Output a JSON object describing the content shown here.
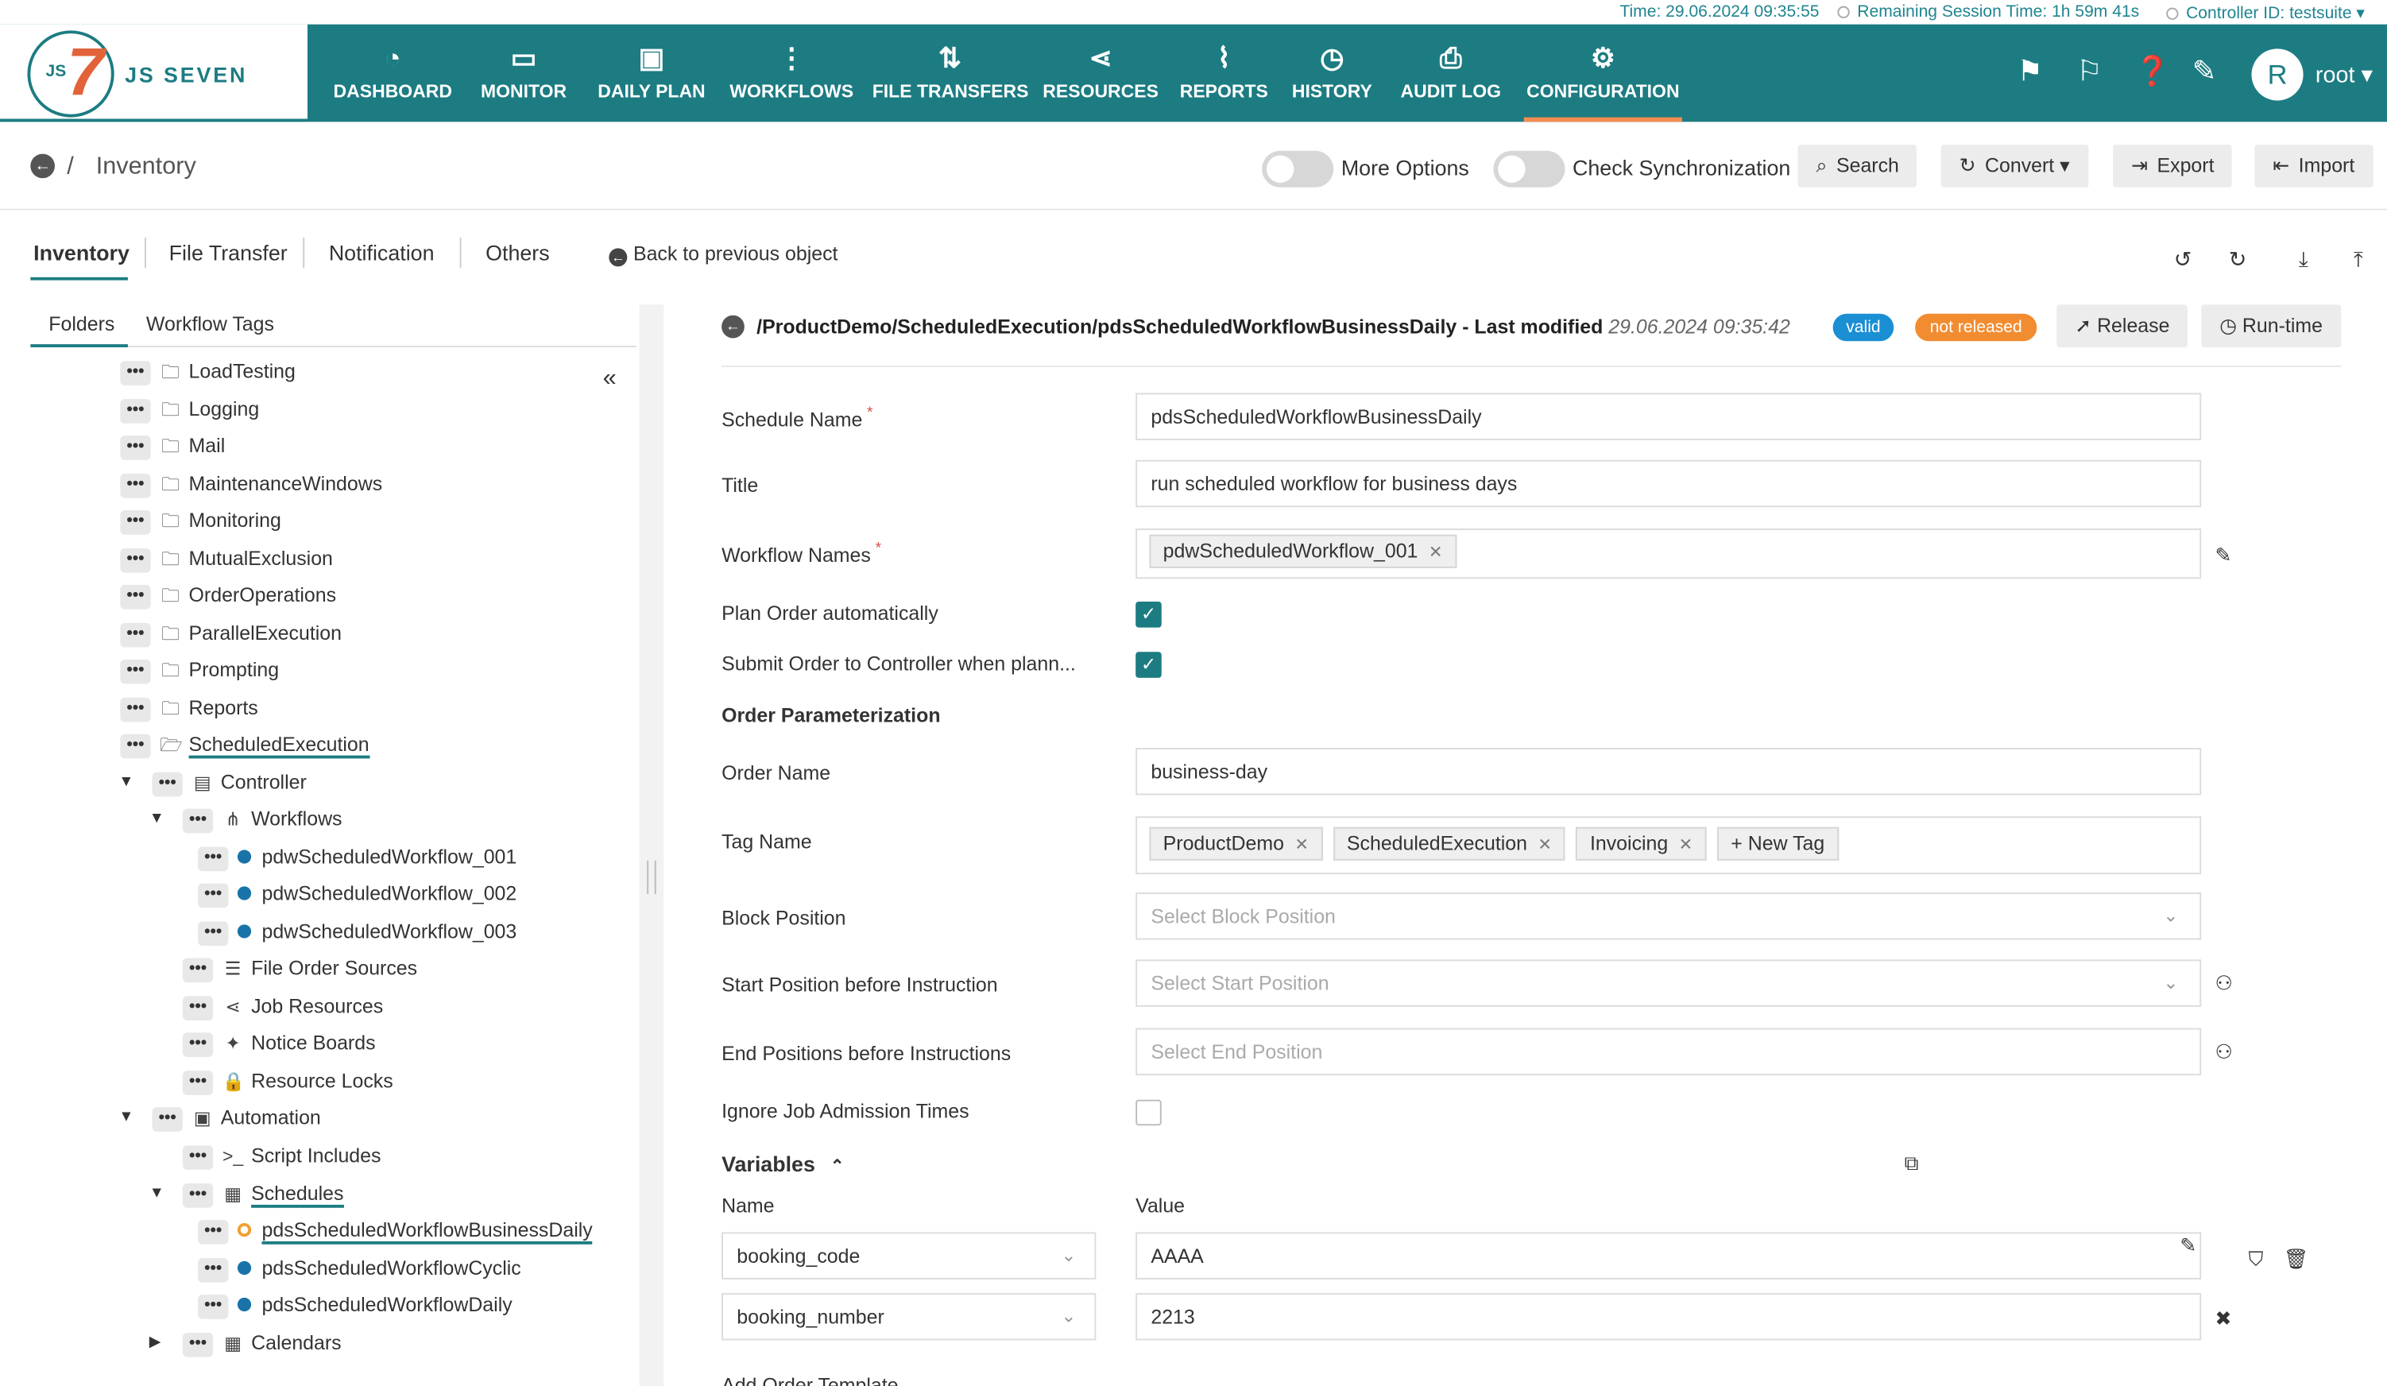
{
  "topbar": {
    "time": "Time: 29.06.2024 09:35:55",
    "session": "Remaining Session Time: 1h 59m 41s",
    "controller": "Controller ID: testsuite"
  },
  "header": {
    "logo_text": "JS SEVEN",
    "logo_js": "JS",
    "logo_seven": "7",
    "nav": [
      {
        "label": "DASHBOARD",
        "icon": "dashboard-icon"
      },
      {
        "label": "MONITOR",
        "icon": "monitor-icon"
      },
      {
        "label": "DAILY PLAN",
        "icon": "calendar-clock-icon"
      },
      {
        "label": "WORKFLOWS",
        "icon": "workflow-icon"
      },
      {
        "label": "FILE TRANSFERS",
        "icon": "transfer-icon"
      },
      {
        "label": "RESOURCES",
        "icon": "share-icon"
      },
      {
        "label": "REPORTS",
        "icon": "chart-icon"
      },
      {
        "label": "HISTORY",
        "icon": "history-icon"
      },
      {
        "label": "AUDIT LOG",
        "icon": "audit-icon"
      },
      {
        "label": "CONFIGURATION",
        "icon": "gear-icon"
      }
    ],
    "avatar_initial": "R",
    "user": "root"
  },
  "toolbar": {
    "title": "Inventory",
    "more_options": "More Options",
    "check_sync": "Check Synchronization",
    "search": "Search",
    "convert": "Convert",
    "export": "Export",
    "import": "Import"
  },
  "tabs": {
    "inventory": "Inventory",
    "file_transfer": "File Transfer",
    "notification": "Notification",
    "others": "Others",
    "back": "Back to previous object"
  },
  "sidebar": {
    "folders": "Folders",
    "workflow_tags": "Workflow Tags",
    "tree": [
      {
        "label": "LoadTesting"
      },
      {
        "label": "Logging"
      },
      {
        "label": "Mail"
      },
      {
        "label": "MaintenanceWindows"
      },
      {
        "label": "Monitoring"
      },
      {
        "label": "MutualExclusion"
      },
      {
        "label": "OrderOperations"
      },
      {
        "label": "ParallelExecution"
      },
      {
        "label": "Prompting"
      },
      {
        "label": "Reports"
      },
      {
        "label": "ScheduledExecution"
      },
      {
        "label": "Controller"
      },
      {
        "label": "Workflows"
      },
      {
        "label": "pdwScheduledWorkflow_001"
      },
      {
        "label": "pdwScheduledWorkflow_002"
      },
      {
        "label": "pdwScheduledWorkflow_003"
      },
      {
        "label": "File Order Sources"
      },
      {
        "label": "Job Resources"
      },
      {
        "label": "Notice Boards"
      },
      {
        "label": "Resource Locks"
      },
      {
        "label": "Automation"
      },
      {
        "label": "Script Includes"
      },
      {
        "label": "Schedules"
      },
      {
        "label": "pdsScheduledWorkflowBusinessDaily"
      },
      {
        "label": "pdsScheduledWorkflowCyclic"
      },
      {
        "label": "pdsScheduledWorkflowDaily"
      },
      {
        "label": "Calendars"
      }
    ]
  },
  "detail": {
    "path": "/ProductDemo/ScheduledExecution/pdsScheduledWorkflowBusinessDaily",
    "last_modified_label": "- Last modified",
    "last_modified": "29.06.2024 09:35:42",
    "valid": "valid",
    "not_released": "not released",
    "release": "Release",
    "runtime": "Run-time",
    "schedule_name_label": "Schedule Name",
    "schedule_name": "pdsScheduledWorkflowBusinessDaily",
    "title_label": "Title",
    "title": "run scheduled workflow for business days",
    "workflow_names_label": "Workflow Names",
    "workflow_names": [
      "pdwScheduledWorkflow_001"
    ],
    "plan_order_label": "Plan Order automatically",
    "submit_order_label": "Submit Order to Controller when plann...",
    "order_param_label": "Order Parameterization",
    "order_name_label": "Order Name",
    "order_name": "business-day",
    "tag_name_label": "Tag Name",
    "tags": [
      "ProductDemo",
      "ScheduledExecution",
      "Invoicing"
    ],
    "new_tag": "New Tag",
    "block_position_label": "Block Position",
    "block_position_ph": "Select Block Position",
    "start_position_label": "Start Position before Instruction",
    "start_position_ph": "Select Start Position",
    "end_positions_label": "End Positions before Instructions",
    "end_positions_ph": "Select End Position",
    "ignore_label": "Ignore Job Admission Times",
    "variables_label": "Variables",
    "name_header": "Name",
    "value_header": "Value",
    "variables": [
      {
        "name": "booking_code",
        "value": "AAAA"
      },
      {
        "name": "booking_number",
        "value": "2213"
      }
    ],
    "add_order_template": "Add Order Template"
  }
}
